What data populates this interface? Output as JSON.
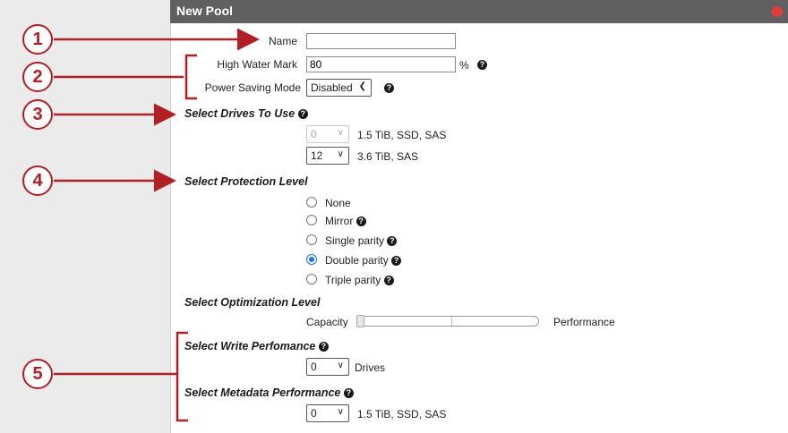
{
  "dialog": {
    "title": "New Pool"
  },
  "fields": {
    "name_label": "Name",
    "name_value": "",
    "hwm_label": "High Water Mark",
    "hwm_value": "80",
    "hwm_unit": "%",
    "power_label": "Power Saving Mode",
    "power_value": "Disabled"
  },
  "drives": {
    "section": "Select Drives To Use",
    "rows": [
      {
        "count": "0",
        "desc": "1.5 TiB, SSD, SAS",
        "disabled": true
      },
      {
        "count": "12",
        "desc": "3.6 TiB, SAS",
        "disabled": false
      }
    ]
  },
  "protection": {
    "section": "Select Protection Level",
    "options": [
      {
        "label": "None",
        "selected": false,
        "help": false
      },
      {
        "label": "Mirror",
        "selected": false,
        "help": true
      },
      {
        "label": "Single parity",
        "selected": false,
        "help": true
      },
      {
        "label": "Double parity",
        "selected": true,
        "help": true
      },
      {
        "label": "Triple parity",
        "selected": false,
        "help": true
      }
    ]
  },
  "optimization": {
    "section": "Select Optimization Level",
    "left_label": "Capacity",
    "right_label": "Performance",
    "level": 0
  },
  "write_perf": {
    "section": "Select Write Perfomance",
    "value": "0",
    "unit": "Drives"
  },
  "metadata_perf": {
    "section": "Select Metadata Performance",
    "value": "0",
    "desc": "1.5 TiB, SSD, SAS"
  },
  "icons": {
    "help": "help-circle-icon",
    "close": "close-circle-icon",
    "dropdown": "chevron-down-icon"
  },
  "callouts": [
    "1",
    "2",
    "3",
    "4",
    "5"
  ],
  "colors": {
    "callout": "#b21f24",
    "titlebar": "#606060",
    "radio_selected": "#1a73e8",
    "close": "#e43c3c"
  }
}
